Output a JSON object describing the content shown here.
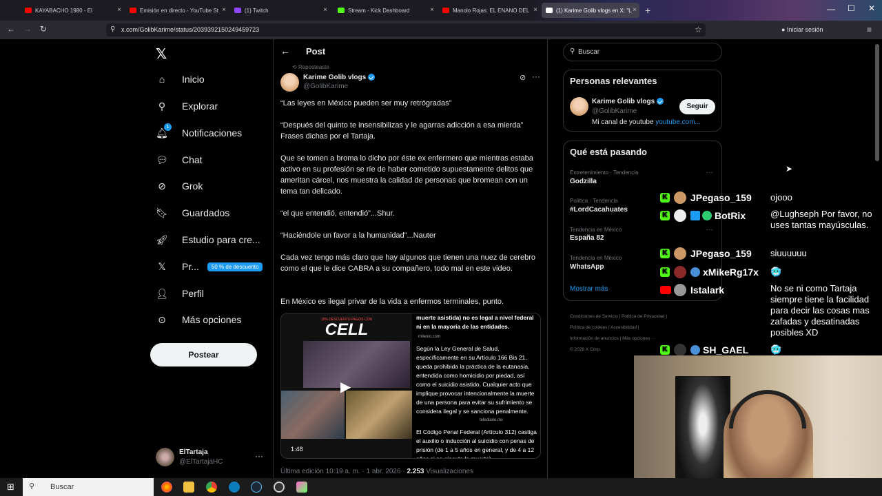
{
  "browser": {
    "tabs": [
      {
        "label": "KAYABACHO 1980 - El",
        "color": "#ff0000"
      },
      {
        "label": "Emisión en directo - YouTube St",
        "color": "#ff0000"
      },
      {
        "label": "(1) Twitch",
        "color": "#9146ff"
      },
      {
        "label": "Stream - Kick Dashboard",
        "color": "#53fc18"
      },
      {
        "label": "Manolo Rojas: EL ENANO DEL",
        "color": "#ff0000"
      },
      {
        "label": "(1) Karime Golib vlogs en X: \"L",
        "color": "#ffffff"
      }
    ],
    "url": "x.com/GolibKarime/status/2039392150249459723",
    "signin_label": "Iniciar sesión"
  },
  "nav": {
    "items": [
      {
        "label": "Inicio",
        "icon": "home-icon"
      },
      {
        "label": "Explorar",
        "icon": "search-icon"
      },
      {
        "label": "Notificaciones",
        "icon": "bell-icon",
        "badge": "1"
      },
      {
        "label": "Chat",
        "icon": "chat-icon"
      },
      {
        "label": "Grok",
        "icon": "grok-icon"
      },
      {
        "label": "Guardados",
        "icon": "bookmark-icon"
      },
      {
        "label": "Estudio para cre...",
        "icon": "rocket-icon"
      },
      {
        "label": "Pr...",
        "icon": "x-premium-icon",
        "badge_text": "50 % de descuento"
      },
      {
        "label": "Perfil",
        "icon": "person-icon"
      },
      {
        "label": "Más opciones",
        "icon": "more-circle-icon"
      }
    ],
    "post_button": "Postear",
    "account": {
      "name": "ElTartaja",
      "handle": "@ElTartajaHC"
    }
  },
  "post": {
    "header_title": "Post",
    "reposted_label": "Reposteaste",
    "author_name": "Karime Golib vlogs",
    "author_handle": "@GolibKarime",
    "paragraphs": [
      "“Las leyes en México pueden ser muy retrógradas”",
      "“Después del quinto te insensibilizas y le agarras adicción a esa mierda” Frases dichas por el Tartaja.",
      "Que se tomen a broma lo dicho por éste ex enfermero que mientras estaba activo en su profesión se ríe de haber cometido supuestamente delitos que ameritan cárcel, nos muestra la calidad de personas que bromean con un tema tan delicado.",
      "“el que entendió, entendió”...Shur.",
      "“Haciéndole un favor a la humanidad”...Nauter",
      "Cada vez tengo más claro que hay algunos que tienen una nuez de cerebro como el que le dice CABRA a su compañero, todo mal en este video.",
      "En México es ilegal privar de la vida a enfermos terminales, punto."
    ],
    "video": {
      "promo_label": "10% DESCUENTO PAGOS CON",
      "brand": "CELL",
      "duration": "1:48",
      "article_top": "muerte asistida) no es legal a nivel federal ni en la mayoría de las entidades.",
      "source1": "milenio.com",
      "article_mid": "Según la Ley General de Salud, específicamente en su Artículo 166 Bis 21, queda prohibida la práctica de la eutanasia, entendida como homicidio por piedad, así como el suicidio asistido. Cualquier acto que implique provocar intencionalmente la muerte de una persona para evitar su sufrimiento se considera ilegal y se sanciona penalmente.",
      "source2": "telediario.mx",
      "article_bottom": "El Código Penal Federal (Artículo 312) castiga el auxilio o inducción al suicidio con penas de prisión (de 1 a 5 años en general, y de 4 a 12 años si se ejecuta la muerte)."
    },
    "footer": {
      "edited": "Última edición 10:19 a. m. · 1 abr. 2026 ·",
      "views": "2.253",
      "views_label": "Visualizaciones"
    }
  },
  "sidebar": {
    "search_placeholder": "Buscar",
    "relevant_title": "Personas relevantes",
    "relevant": {
      "name": "Karime Golib vlogs",
      "handle": "@GolibKarime",
      "bio": "Mi canal de youtube",
      "link": "youtube.com...",
      "follow": "Seguir"
    },
    "trends_title": "Qué está pasando",
    "trends": [
      {
        "context": "Entretenimiento · Tendencia",
        "name": "Godzilla"
      },
      {
        "context": "Política · Tendencia",
        "name": "#LordCacahuates"
      },
      {
        "context": "Tendencia en México",
        "name": "España 82"
      },
      {
        "context": "Tendencia en México",
        "name": "WhatsApp"
      }
    ],
    "show_more": "Mostrar más",
    "footer_links": [
      "Condiciones de Servicio",
      "Política de Privacidad",
      "Política de cookies",
      "Accesibilidad",
      "Información de anuncios",
      "Más opciones ···",
      "© 2026 X Corp."
    ]
  },
  "chat": {
    "messages": [
      {
        "user": "JPegaso_159",
        "text": "ojooo"
      },
      {
        "user": "BotRix",
        "text": "@Lughseph Por favor, no uses tantas mayúsculas."
      },
      {
        "user": "JPegaso_159",
        "text": "siuuuuuu"
      },
      {
        "user": "xMikeRg17x",
        "text": "🥶"
      },
      {
        "user": "Istalark",
        "text": "No se ni como Tartaja siempre tiene la facilidad para decir las cosas mas zafadas y desatinadas posibles XD"
      },
      {
        "user": "SH_GAEL",
        "text": "🥶"
      }
    ]
  },
  "taskbar": {
    "search": "Buscar"
  }
}
